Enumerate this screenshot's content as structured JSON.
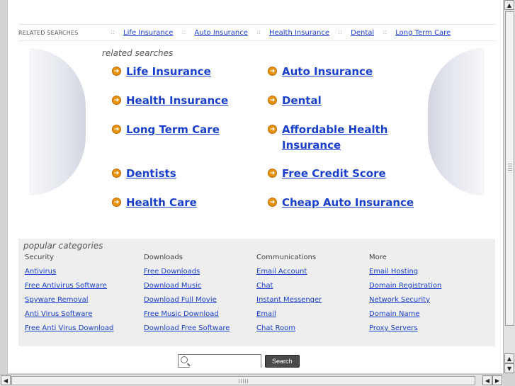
{
  "topbar": {
    "label": "RELATED SEARCHES",
    "links": [
      "Life Insurance",
      "Auto Insurance",
      "Health Insurance",
      "Dental",
      "Long Term Care"
    ],
    "separator": "::"
  },
  "related": {
    "title": "related searches",
    "left": [
      "Life Insurance",
      "Health Insurance",
      "Long Term Care",
      "Dentists",
      "Health Care"
    ],
    "right": [
      "Auto Insurance",
      "Dental",
      "Affordable Health Insurance",
      "Free Credit Score",
      "Cheap Auto Insurance"
    ]
  },
  "popular": {
    "title": "popular categories",
    "columns": [
      {
        "heading": "Security",
        "links": [
          "Antivirus",
          "Free Antivirus Software",
          "Spyware Removal",
          "Anti Virus Software",
          "Free Anti Virus Download"
        ]
      },
      {
        "heading": "Downloads",
        "links": [
          "Free Downloads",
          "Download Music",
          "Download Full Movie",
          "Free Music Download",
          "Download Free Software"
        ]
      },
      {
        "heading": "Communications",
        "links": [
          "Email Account",
          "Chat",
          "Instant Messenger",
          "Email",
          "Chat Room"
        ]
      },
      {
        "heading": "More",
        "links": [
          "Email Hosting",
          "Domain Registration",
          "Network Security",
          "Domain Name",
          "Proxy Servers"
        ]
      }
    ]
  },
  "search": {
    "value": "",
    "button": "Search"
  },
  "colors": {
    "link": "#1a3fcc",
    "arrow": "#e8920e",
    "panel": "#eeeeee"
  },
  "icons": {
    "arrow": "arrow-circle-icon",
    "search": "magnifier-icon"
  }
}
